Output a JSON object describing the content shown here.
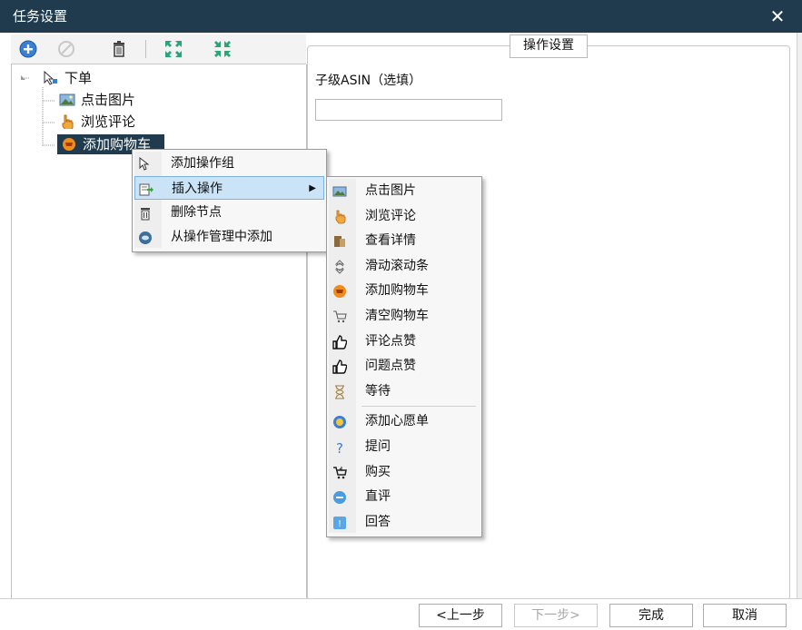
{
  "window": {
    "title": "任务设置",
    "close_symbol": "✕"
  },
  "toolbar": {
    "icons": [
      "add-icon",
      "disable-icon",
      "trash-icon",
      "expand-icon",
      "collapse-icon"
    ]
  },
  "tree": {
    "root": "下单",
    "children": [
      "点击图片",
      "浏览评论",
      "添加购物车"
    ],
    "selected": "添加购物车"
  },
  "settings": {
    "tab_label": "操作设置",
    "asin_label": "子级ASIN（选填）",
    "asin_value": "",
    "asin_placeholder": ""
  },
  "context_menu": {
    "items": [
      "添加操作组",
      "插入操作",
      "删除节点",
      "从操作管理中添加"
    ],
    "highlighted": "插入操作",
    "submenu_arrow": "▶"
  },
  "submenu": {
    "items": [
      "点击图片",
      "浏览评论",
      "查看详情",
      "滑动滚动条",
      "添加购物车",
      "清空购物车",
      "评论点赞",
      "问题点赞",
      "等待",
      "添加心愿单",
      "提问",
      "购买",
      "直评",
      "回答"
    ]
  },
  "buttons": {
    "prev": "<上一步",
    "next": "下一步>",
    "finish": "完成",
    "cancel": "取消"
  },
  "colors": {
    "titlebar": "#1f3b4d",
    "selection": "#1f3b4d",
    "menu_highlight": "#cbe3f6"
  }
}
